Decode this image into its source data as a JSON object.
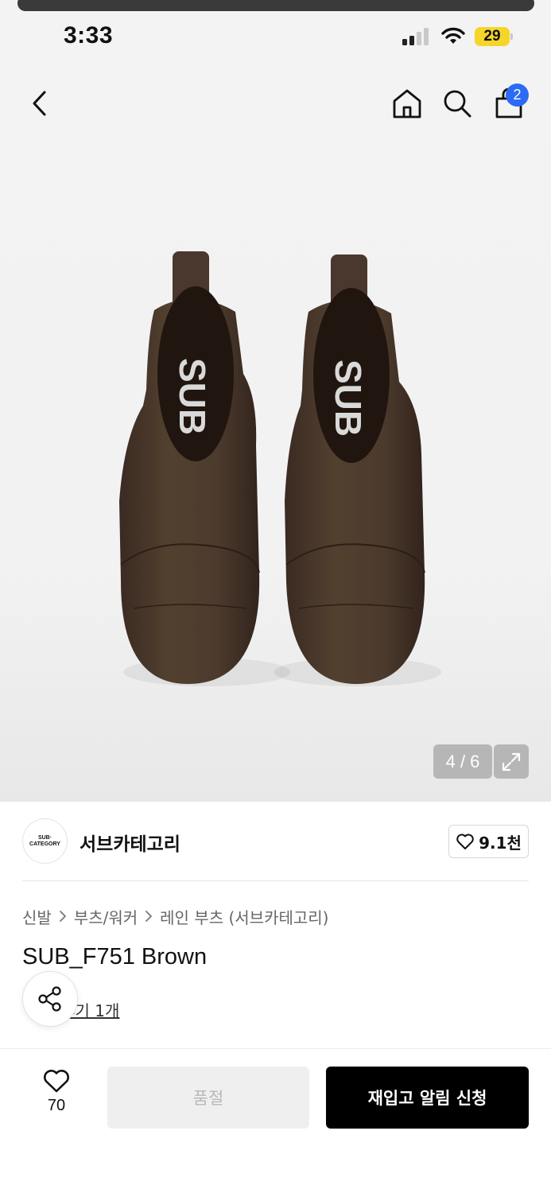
{
  "status_bar": {
    "time": "3:33",
    "battery": "29"
  },
  "header": {
    "cart_count": "2"
  },
  "gallery": {
    "counter": "4 / 6",
    "image_label": "SUB"
  },
  "brand": {
    "logo_line1": "SUB·",
    "logo_line2": "CATEGORY",
    "name": "서브카테고리",
    "like_count": "9.1천"
  },
  "breadcrumb": [
    {
      "label": "신발"
    },
    {
      "label": "부츠/워커"
    },
    {
      "label": "레인 부츠 (서브카테고리)"
    }
  ],
  "product": {
    "title": "SUB_F751 Brown",
    "review_link": "후기 1개"
  },
  "bottom_bar": {
    "like_count": "70",
    "soldout_label": "품절",
    "restock_label": "재입고 알림 신청"
  },
  "colors": {
    "accent_badge": "#2b6bf3",
    "battery": "#f6d52a",
    "boot": "#4a372d"
  }
}
